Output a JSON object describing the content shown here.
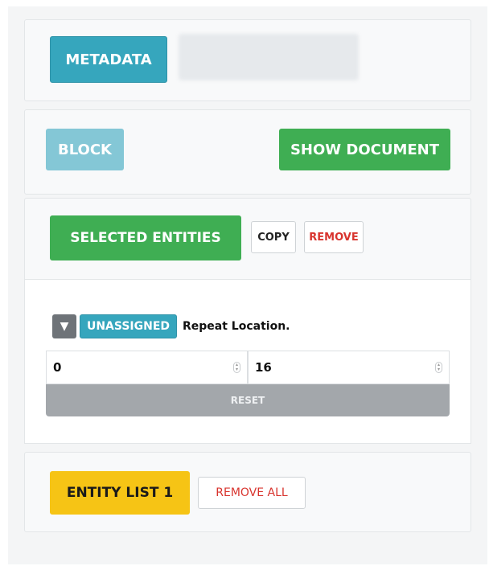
{
  "metadata_panel": {
    "metadata_label": "METADATA"
  },
  "actions_panel": {
    "block_label": "BLOCK",
    "show_document_label": "SHOW DOCUMENT"
  },
  "selection_panel": {
    "selected_entities_label": "SELECTED ENTITIES",
    "copy_label": "COPY",
    "remove_label": "REMOVE"
  },
  "entity": {
    "toggle_icon": "triangle-down-icon",
    "toggle_glyph": "▼",
    "badge_label": "UNASSIGNED",
    "text": "Repeat Location.",
    "start_value": "0",
    "end_value": "16",
    "reset_label": "RESET"
  },
  "entity_list_panel": {
    "list_label": "ENTITY LIST 1",
    "remove_all_label": "REMOVE ALL"
  },
  "colors": {
    "info": "#36a6bd",
    "success": "#3fae53",
    "warning": "#f6c415",
    "danger_text": "#d8342e",
    "reset_gray": "#a3a7ab"
  }
}
